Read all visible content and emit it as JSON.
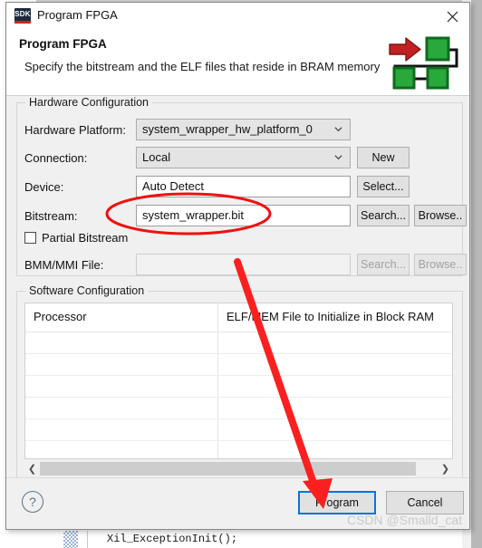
{
  "window": {
    "title": "Program FPGA",
    "app_icon": "sdk-icon",
    "app_icon_text": "SDK",
    "close_icon": "close-icon"
  },
  "header": {
    "title": "Program FPGA",
    "subtitle": "Specify the bitstream and the ELF files that reside in BRAM memory",
    "graphic": "fpga-flow-icon"
  },
  "hardware_configuration": {
    "group_title": "Hardware Configuration",
    "hardware_platform": {
      "label": "Hardware Platform:",
      "value": "system_wrapper_hw_platform_0"
    },
    "connection": {
      "label": "Connection:",
      "value": "Local",
      "new_button": "New"
    },
    "device": {
      "label": "Device:",
      "value": "Auto Detect",
      "select_button": "Select..."
    },
    "bitstream": {
      "label": "Bitstream:",
      "value": "system_wrapper.bit",
      "search_button": "Search...",
      "browse_button": "Browse.."
    },
    "partial_bitstream": {
      "label": "Partial Bitstream",
      "checked": false
    },
    "bmm_mmi": {
      "label": "BMM/MMI File:",
      "value": "",
      "placeholder": "",
      "search_button": "Search...",
      "browse_button": "Browse..",
      "disabled": true
    }
  },
  "software_configuration": {
    "group_title": "Software Configuration",
    "table": {
      "columns": [
        "Processor",
        "ELF/MEM File to Initialize in Block RAM"
      ],
      "rows": [],
      "empty_row_count": 7
    },
    "scrollbar": {
      "left_arrow": "chevron-left-icon",
      "right_arrow": "chevron-right-icon"
    }
  },
  "footer": {
    "help_icon": "help-icon",
    "help_glyph": "?",
    "program_button": "Program",
    "cancel_button": "Cancel"
  },
  "watermark": {
    "text": "CSDN @Smalld_cat"
  },
  "background": {
    "code_line": "Xil_ExceptionInit();"
  },
  "annotations": {
    "ellipse_color": "#ee1111",
    "arrow_color": "#fb2020",
    "ellipse_target": "bitstream-field",
    "arrow_target": "program-button"
  },
  "colors": {
    "accent": "#0a74d8",
    "annotation_red": "#ee1111",
    "dialog_bg": "#f0f0f0",
    "icon_green": "#1f9b34",
    "icon_red": "#b02020"
  }
}
